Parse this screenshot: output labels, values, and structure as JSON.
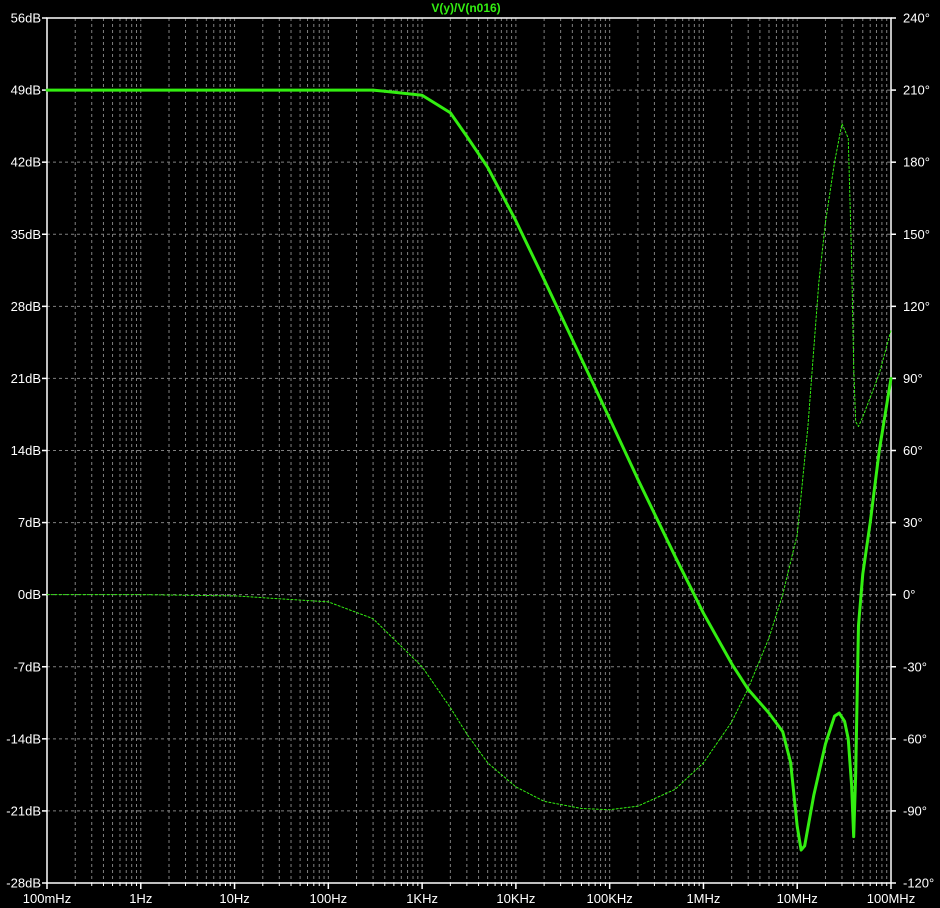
{
  "chart_data": {
    "type": "line",
    "title": "V(y)/V(n016)",
    "x_scale": "log",
    "xlim": [
      0.1,
      100000000
    ],
    "x_ticks": [
      {
        "value": 0.1,
        "label": "100mHz"
      },
      {
        "value": 1,
        "label": "1Hz"
      },
      {
        "value": 10,
        "label": "10Hz"
      },
      {
        "value": 100,
        "label": "100Hz"
      },
      {
        "value": 1000,
        "label": "1KHz"
      },
      {
        "value": 10000,
        "label": "10KHz"
      },
      {
        "value": 100000,
        "label": "100KHz"
      },
      {
        "value": 1000000,
        "label": "1MHz"
      },
      {
        "value": 10000000,
        "label": "10MHz"
      },
      {
        "value": 100000000,
        "label": "100MHz"
      }
    ],
    "y_left": {
      "lim": [
        -28,
        56
      ],
      "ticks": [
        {
          "value": 56,
          "label": "56dB"
        },
        {
          "value": 49,
          "label": "49dB"
        },
        {
          "value": 42,
          "label": "42dB"
        },
        {
          "value": 35,
          "label": "35dB"
        },
        {
          "value": 28,
          "label": "28dB"
        },
        {
          "value": 21,
          "label": "21dB"
        },
        {
          "value": 14,
          "label": "14dB"
        },
        {
          "value": 7,
          "label": "7dB"
        },
        {
          "value": 0,
          "label": "0dB"
        },
        {
          "value": -7,
          "label": "-7dB"
        },
        {
          "value": -14,
          "label": "-14dB"
        },
        {
          "value": -21,
          "label": "-21dB"
        },
        {
          "value": -28,
          "label": "-28dB"
        }
      ]
    },
    "y_right": {
      "lim": [
        -120,
        240
      ],
      "ticks": [
        {
          "value": 240,
          "label": "240°"
        },
        {
          "value": 210,
          "label": "210°"
        },
        {
          "value": 180,
          "label": "180°"
        },
        {
          "value": 150,
          "label": "150°"
        },
        {
          "value": 120,
          "label": "120°"
        },
        {
          "value": 90,
          "label": "90°"
        },
        {
          "value": 60,
          "label": "60°"
        },
        {
          "value": 30,
          "label": "30°"
        },
        {
          "value": 0,
          "label": "0°"
        },
        {
          "value": -30,
          "label": "-30°"
        },
        {
          "value": -60,
          "label": "-60°"
        },
        {
          "value": -90,
          "label": "-90°"
        },
        {
          "value": -120,
          "label": "-120°"
        }
      ]
    },
    "grid": true,
    "series": [
      {
        "kind": "magnitude",
        "axis": "left",
        "color": "#33ee11",
        "style": "solid",
        "x": [
          0.1,
          1,
          10,
          100,
          300,
          1000,
          2000,
          3000,
          5000,
          10000,
          20000,
          50000,
          100000,
          200000,
          500000,
          1000000,
          2000000,
          3000000,
          5000000,
          7000000,
          8500000,
          10000000,
          11000000,
          12000000,
          15000000,
          20000000,
          25000000,
          28000000,
          32000000,
          35000000,
          38000000,
          40000000,
          42000000,
          45000000,
          50000000,
          60000000,
          75000000,
          100000000
        ],
        "y": [
          49.0,
          49.0,
          49.0,
          49.0,
          49.0,
          48.5,
          46.8,
          44.5,
          41.5,
          36.3,
          30.6,
          22.9,
          17.1,
          11.2,
          3.7,
          -1.8,
          -6.7,
          -9.2,
          -11.5,
          -13.3,
          -16.3,
          -22.5,
          -24.8,
          -24.4,
          -19.5,
          -14.5,
          -11.8,
          -11.5,
          -12.3,
          -14.0,
          -18.5,
          -23.5,
          -17.5,
          -3.0,
          2.0,
          7.0,
          14.0,
          21.0
        ]
      },
      {
        "kind": "phase",
        "axis": "right",
        "color": "#33ee11",
        "style": "dashed",
        "x": [
          0.1,
          1,
          10,
          100,
          300,
          1000,
          2000,
          3000,
          5000,
          10000,
          20000,
          50000,
          100000,
          200000,
          500000,
          1000000,
          2000000,
          3000000,
          5000000,
          7000000,
          10000000,
          13000000,
          17000000,
          20000000,
          25000000,
          30000000,
          35000000,
          38000000,
          40000000,
          42000000,
          45000000,
          50000000,
          60000000,
          75000000,
          100000000
        ],
        "y": [
          0,
          0,
          -0.5,
          -3,
          -10,
          -30,
          -47,
          -58,
          -70,
          -80,
          -86,
          -89,
          -89.5,
          -88,
          -81,
          -70,
          -53,
          -39,
          -18,
          0,
          25,
          70,
          130,
          155,
          180,
          196,
          190,
          140,
          95,
          72,
          70,
          74,
          82,
          92,
          110
        ]
      }
    ]
  }
}
